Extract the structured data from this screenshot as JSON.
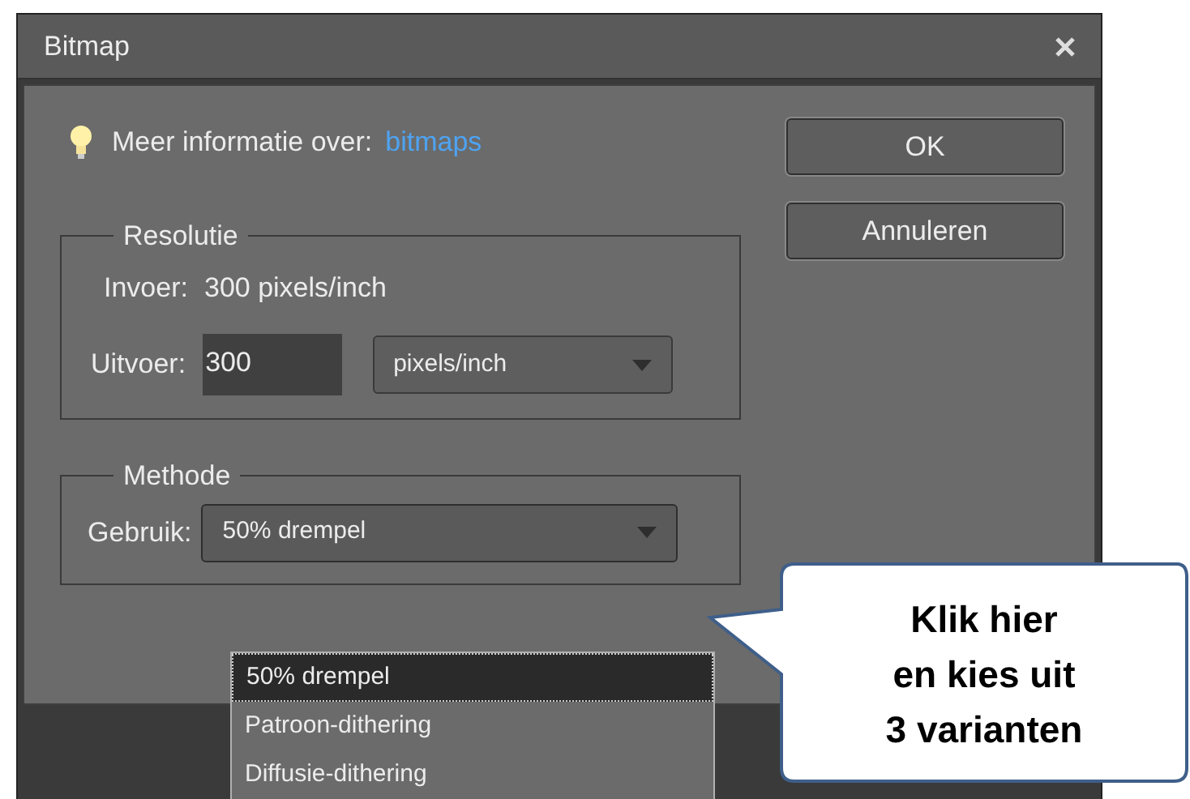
{
  "window": {
    "title": "Bitmap"
  },
  "info": {
    "label": "Meer informatie over:",
    "link": "bitmaps"
  },
  "buttons": [
    "OK",
    "Annuleren"
  ],
  "resolution": {
    "title": "Resolutie",
    "input_label": "Invoer:",
    "input_value": "300 pixels/inch",
    "output_label": "Uitvoer:",
    "output_value": "300",
    "unit": "pixels/inch"
  },
  "method": {
    "title": "Methode",
    "label": "Gebruik:",
    "value": "50% drempel",
    "expanded": true,
    "options": [
      {
        "label": "50% drempel",
        "selected": true
      },
      {
        "label": "Patroon-dithering",
        "selected": false
      },
      {
        "label": "Diffusie-dithering",
        "selected": false
      }
    ]
  },
  "callout": {
    "lines": [
      "Klik hier",
      "en kies uit",
      "3 varianten"
    ]
  }
}
